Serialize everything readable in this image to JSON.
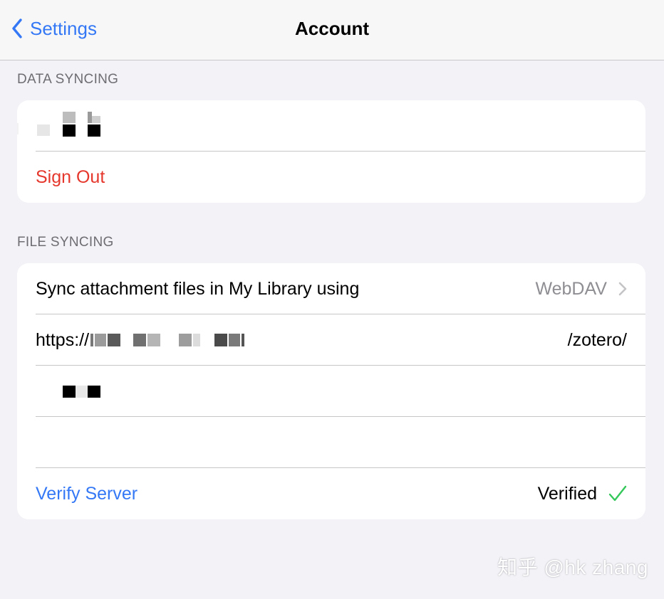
{
  "nav": {
    "back_label": "Settings",
    "title": "Account"
  },
  "data_syncing": {
    "header": "DATA SYNCING",
    "sign_out_label": "Sign Out"
  },
  "file_syncing": {
    "header": "FILE SYNCING",
    "sync_row_label": "Sync attachment files in My Library using",
    "sync_row_value": "WebDAV",
    "url_prefix": "https://",
    "url_suffix": "/zotero/",
    "verify_label": "Verify Server",
    "verified_label": "Verified"
  },
  "watermark": "知乎 @hk zhang",
  "colors": {
    "accent_blue": "#3478f6",
    "destructive_red": "#e5372c",
    "verified_green": "#34c759",
    "background": "#f2f2f7"
  },
  "icons": {
    "back": "chevron-left-icon",
    "disclosure": "chevron-right-icon",
    "verified": "checkmark-icon"
  }
}
